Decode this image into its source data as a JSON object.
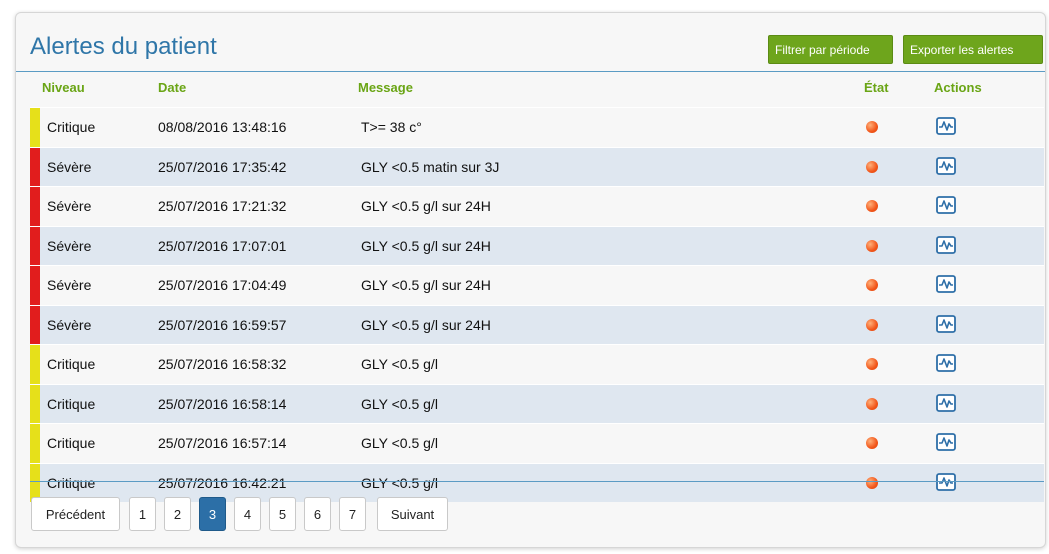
{
  "header": {
    "title": "Alertes du patient",
    "filter_label": "Filtrer par période",
    "export_label": "Exporter les alertes"
  },
  "columns": {
    "level": "Niveau",
    "date": "Date",
    "message": "Message",
    "state": "État",
    "actions": "Actions"
  },
  "colors": {
    "critique": "#e6e01a",
    "severe": "#e11d1d",
    "state_dot": "#f2561a",
    "action_icon": "#2e6fa8"
  },
  "rows": [
    {
      "level": "Critique",
      "date": "08/08/2016 13:48:16",
      "message": "T>= 38 c°",
      "severity": "critique"
    },
    {
      "level": "Sévère",
      "date": "25/07/2016 17:35:42",
      "message": "GLY <0.5 matin sur 3J",
      "severity": "severe"
    },
    {
      "level": "Sévère",
      "date": "25/07/2016 17:21:32",
      "message": "GLY <0.5 g/l sur 24H",
      "severity": "severe"
    },
    {
      "level": "Sévère",
      "date": "25/07/2016 17:07:01",
      "message": "GLY <0.5 g/l sur 24H",
      "severity": "severe"
    },
    {
      "level": "Sévère",
      "date": "25/07/2016 17:04:49",
      "message": "GLY <0.5 g/l sur 24H",
      "severity": "severe"
    },
    {
      "level": "Sévère",
      "date": "25/07/2016 16:59:57",
      "message": "GLY <0.5 g/l sur 24H",
      "severity": "severe"
    },
    {
      "level": "Critique",
      "date": "25/07/2016 16:58:32",
      "message": "GLY <0.5 g/l",
      "severity": "critique"
    },
    {
      "level": "Critique",
      "date": "25/07/2016 16:58:14",
      "message": "GLY <0.5 g/l",
      "severity": "critique"
    },
    {
      "level": "Critique",
      "date": "25/07/2016 16:57:14",
      "message": "GLY <0.5 g/l",
      "severity": "critique"
    },
    {
      "level": "Critique",
      "date": "25/07/2016 16:42:21",
      "message": "GLY <0.5 g/l",
      "severity": "critique"
    }
  ],
  "pagination": {
    "prev_label": "Précédent",
    "next_label": "Suivant",
    "pages": [
      "1",
      "2",
      "3",
      "4",
      "5",
      "6",
      "7"
    ],
    "current": "3"
  }
}
